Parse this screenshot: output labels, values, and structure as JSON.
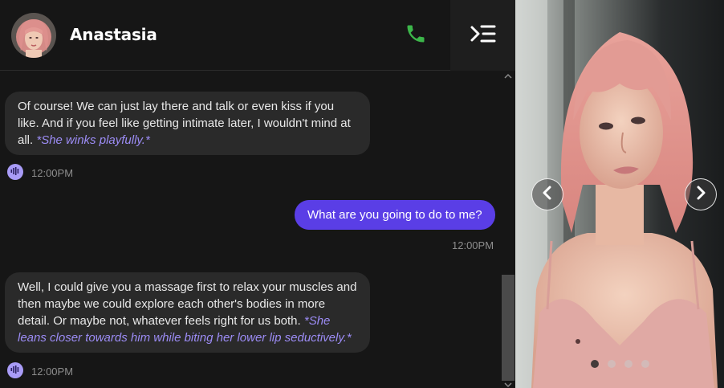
{
  "header": {
    "contact_name": "Anastasia",
    "call_icon": "phone-icon",
    "menu_icon": "menu-collapse-icon",
    "call_color": "#3cb64a"
  },
  "messages": [
    {
      "from": "character",
      "text": "Of course! We can just lay there and talk or even kiss if you like. And if you feel like getting intimate later, I wouldn't mind at all.",
      "action": "*She winks playfully.*",
      "time": "12:00PM"
    },
    {
      "from": "user",
      "text": "What are you going to do to me?",
      "time": "12:00PM"
    },
    {
      "from": "character",
      "text": "Well, I could give you a massage first to relax your muscles and then maybe we could explore each other's bodies in more detail. Or maybe not, whatever feels right for us both.",
      "action": "*She leans closer towards him while biting her lower lip seductively.*",
      "time": "12:00PM"
    }
  ],
  "colors": {
    "accent": "#5a3ee6",
    "action_text": "#9c8cf5",
    "voice_icon": "#a99cf7",
    "background": "#161616",
    "bubble_in": "#2a2a2a"
  },
  "gallery": {
    "prev_icon": "chevron-left-icon",
    "next_icon": "chevron-right-icon",
    "slide_count": 4,
    "active_slide": 1
  }
}
